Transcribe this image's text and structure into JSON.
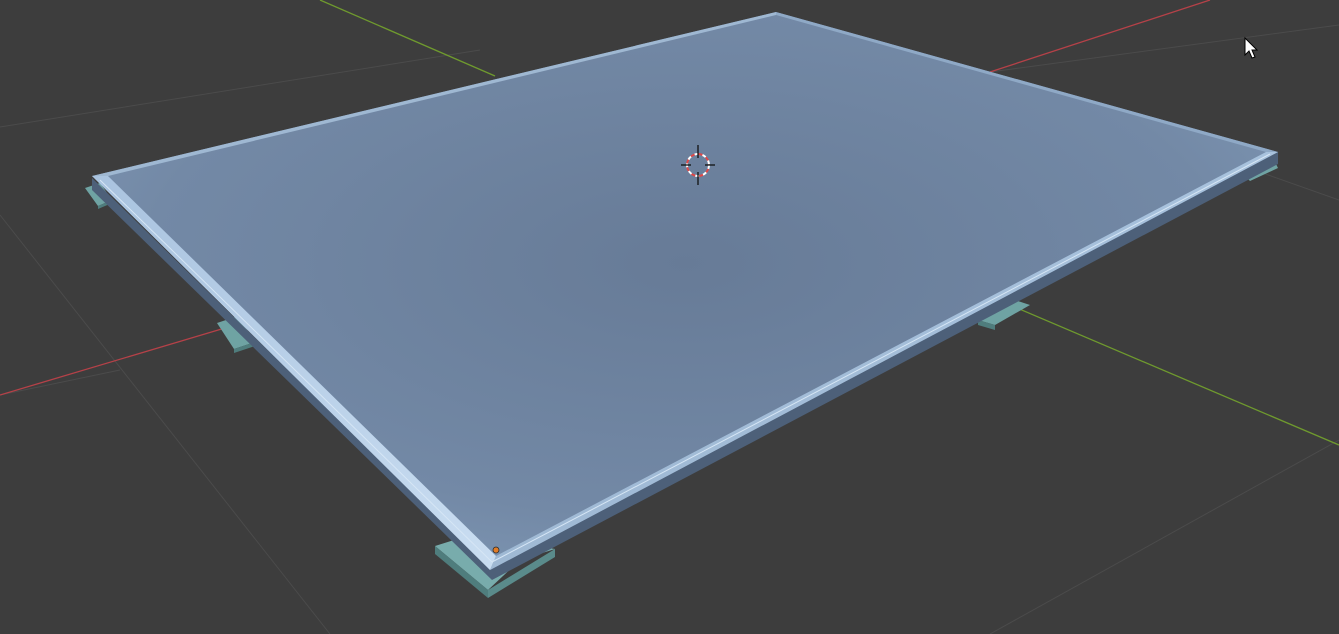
{
  "viewport": {
    "background_color": "#3d3d3d",
    "grid_color": "#4a4a4a",
    "x_axis_color": "#b54148",
    "y_axis_color": "#6f9a2e"
  },
  "scene": {
    "plate": {
      "top_color": "#7389a6",
      "edge_color": "#9fbad6",
      "bevel_highlight_color": "#c3d8ee",
      "side_shadow_color": "#4d6079"
    },
    "feet": {
      "color": "#6fa3a3",
      "count": 5
    },
    "origin_dot": {
      "color": "#e07b26"
    },
    "cursor_3d": {
      "icon": "3d-cursor-icon",
      "ring_colors": [
        "#ffffff",
        "#e04848"
      ]
    }
  },
  "mouse_pointer": {
    "icon": "mouse-pointer-icon",
    "color": "#ffffff"
  }
}
